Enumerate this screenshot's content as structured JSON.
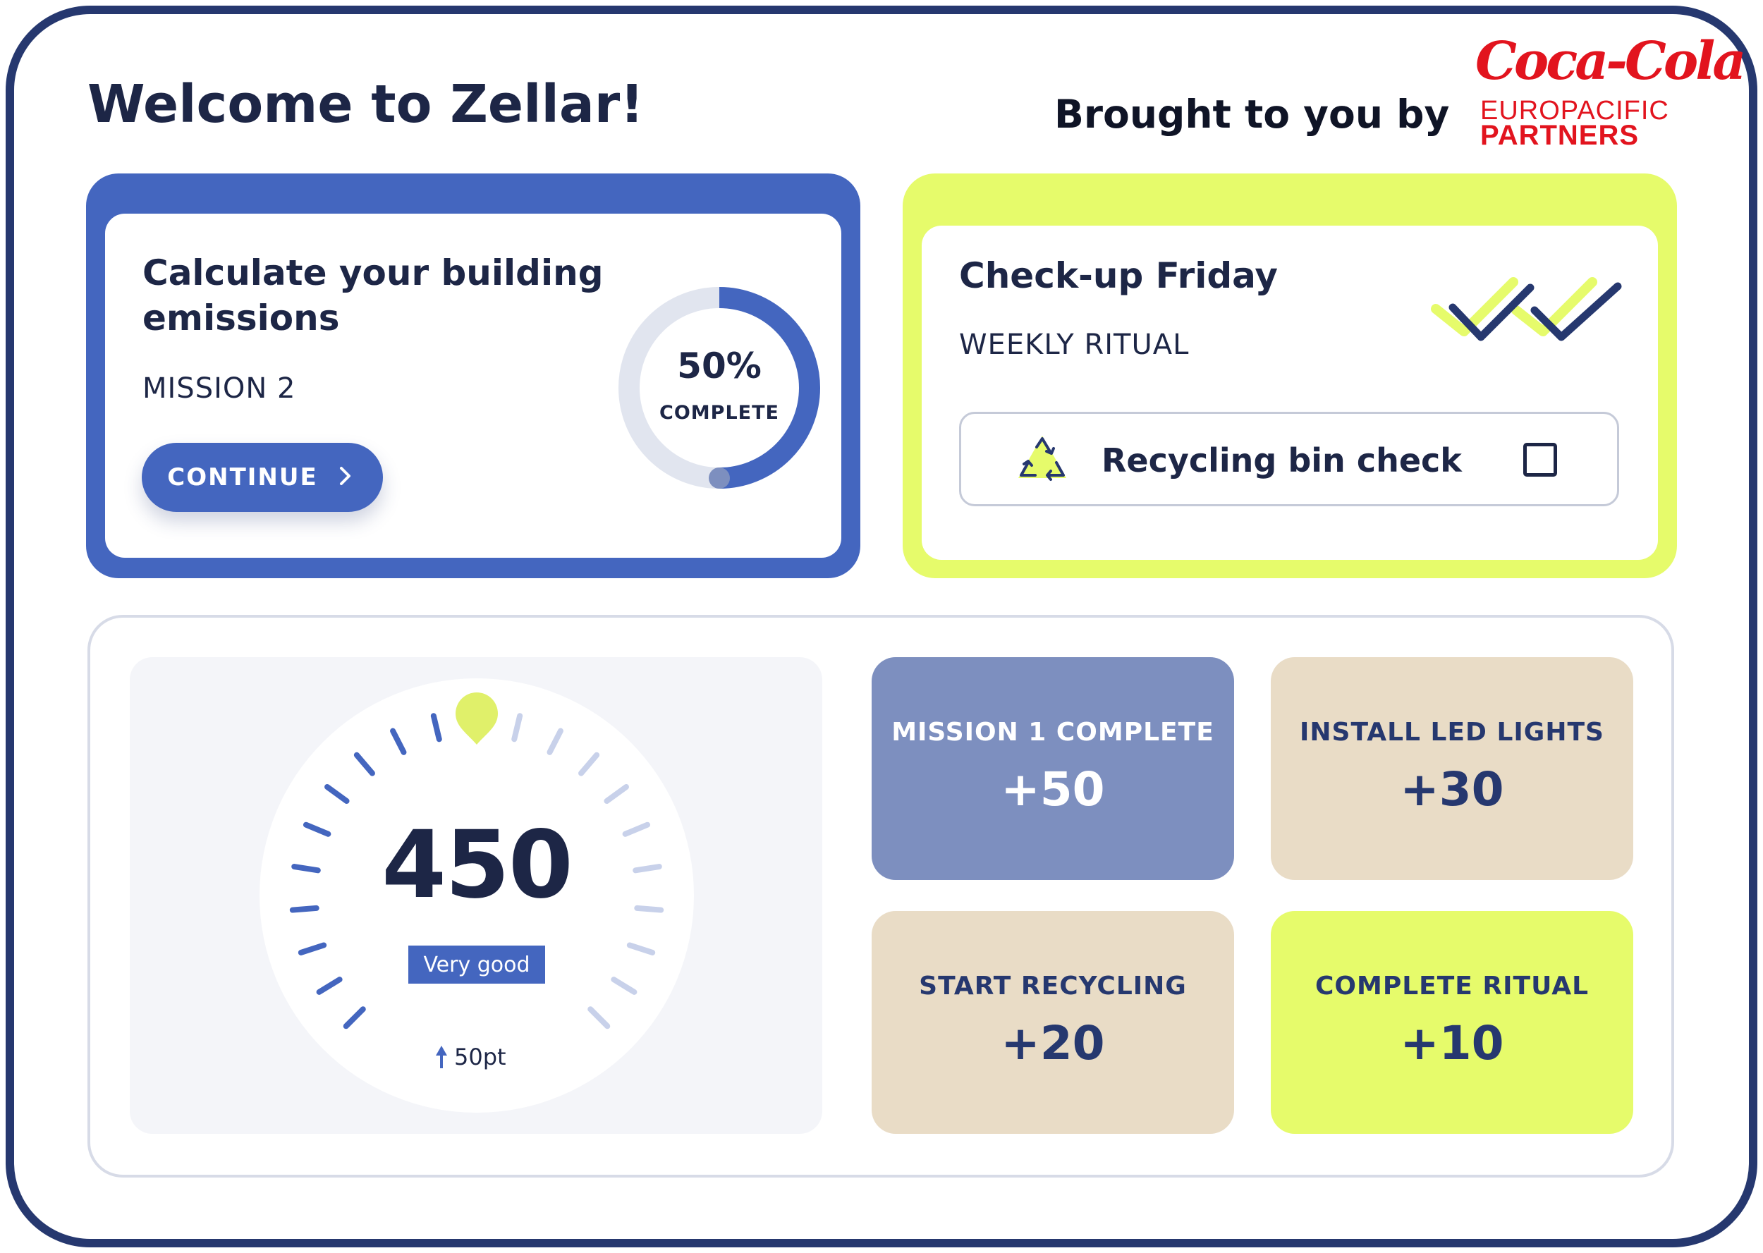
{
  "header": {
    "title": "Welcome to Zellar!",
    "sponsor_text": "Brought to you by",
    "sponsor_logo": {
      "script": "Coca-Cola",
      "line1": "EUROPACIFIC",
      "line2": "PARTNERS"
    }
  },
  "mission_card": {
    "title": "Calculate your building emissions",
    "subtitle": "MISSION 2",
    "continue_label": "CONTINUE",
    "progress_percent": 50,
    "progress_text": "50%",
    "progress_label": "COMPLETE"
  },
  "ritual_card": {
    "title": "Check-up Friday",
    "subtitle": "WEEKLY RITUAL",
    "task_label": "Recycling bin check",
    "task_checked": false
  },
  "score_panel": {
    "score": "450",
    "rating": "Very good",
    "change": "50pt",
    "level_fraction": 0.5
  },
  "reward_tiles": [
    {
      "label": "MISSION 1 COMPLETE",
      "points": "+50",
      "bg": "#7d8fbf",
      "fg": "#ffffff"
    },
    {
      "label": "INSTALL LED LIGHTS",
      "points": "+30",
      "bg": "#e9dcc6",
      "fg": "#26386f"
    },
    {
      "label": "START RECYCLING",
      "points": "+20",
      "bg": "#e9dcc6",
      "fg": "#26386f"
    },
    {
      "label": "COMPLETE RITUAL",
      "points": "+10",
      "bg": "#e6fb6b",
      "fg": "#26386f"
    }
  ],
  "colors": {
    "frame": "#26386f",
    "primary_blue": "#4466bf",
    "lime": "#e6fb6b",
    "navy_text": "#1d2646",
    "sponsor_red": "#e2141e"
  }
}
